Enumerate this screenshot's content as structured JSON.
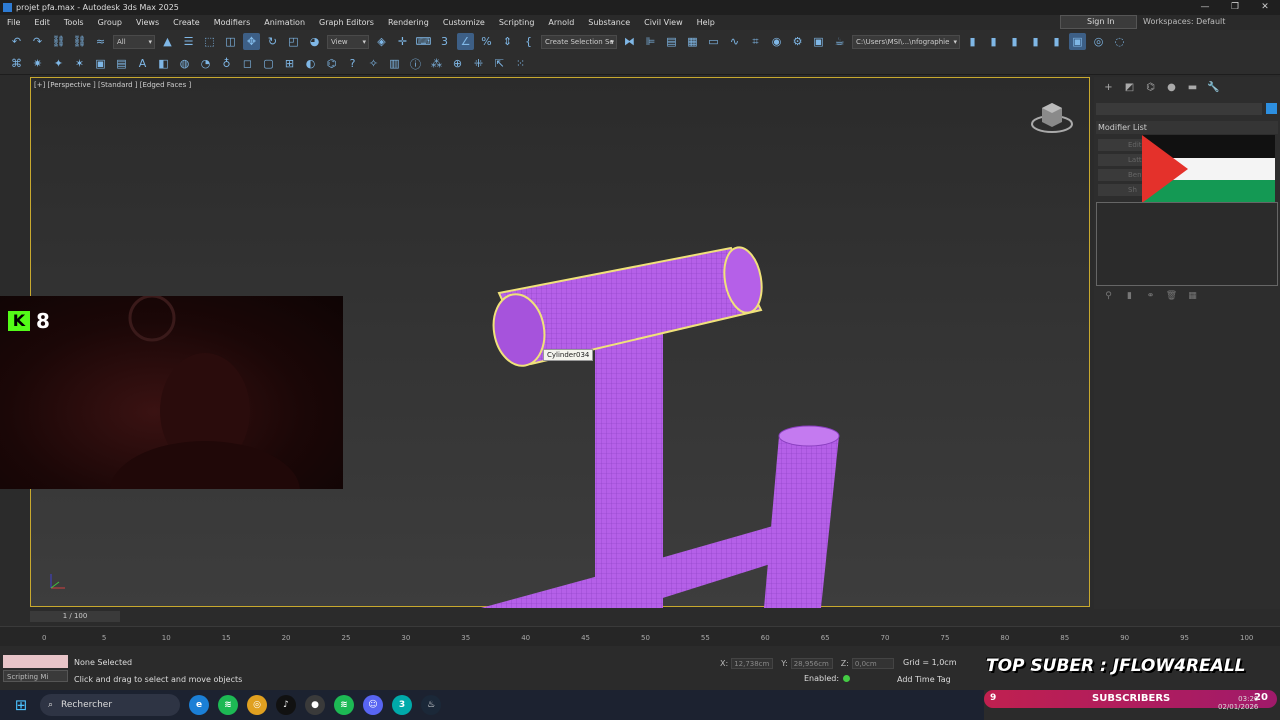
{
  "window": {
    "title": "projet pfa.max - Autodesk 3ds Max 2025",
    "controls": [
      "—",
      "❐",
      "✕"
    ]
  },
  "menu": [
    "File",
    "Edit",
    "Tools",
    "Group",
    "Views",
    "Create",
    "Modifiers",
    "Animation",
    "Graph Editors",
    "Rendering",
    "Customize",
    "Scripting",
    "Arnold",
    "Substance",
    "Civil View",
    "Help"
  ],
  "account": {
    "sign_in": "Sign In",
    "workspaces_label": "Workspaces:",
    "workspace": "Default"
  },
  "toolbar": {
    "filter": "All",
    "ref_coord": "View",
    "selection_set": "Create Selection Se",
    "path": "C:\\Users\\MSI\\...\\nfographie"
  },
  "viewport": {
    "label": "[+] [Perspective ] [Standard ] [Edged Faces ]",
    "tooltip": "Cylinder034",
    "object_color": "#b05fe0",
    "selection_color": "#f0e27a"
  },
  "command_panel": {
    "modifier_list": "Modifier List",
    "modifier_buttons": [
      "Edit",
      "Latt",
      "Ben",
      "Sh"
    ],
    "sel_color": "#2d8fe0"
  },
  "webcam": {
    "kick_logo": "K",
    "viewer_count": "8"
  },
  "timeline": {
    "frame": "1 / 100",
    "ticks": [
      "0",
      "5",
      "10",
      "15",
      "20",
      "25",
      "30",
      "35",
      "40",
      "45",
      "50",
      "55",
      "60",
      "65",
      "70",
      "75",
      "80",
      "85",
      "90",
      "95",
      "100"
    ]
  },
  "status": {
    "maxscript_label": "Scripting Mi",
    "selection": "None Selected",
    "prompt": "Click and drag to select and move objects",
    "x_label": "X:",
    "x_value": "12,738cm",
    "y_label": "Y:",
    "y_value": "28,956cm",
    "z_label": "Z:",
    "z_value": "0,0cm",
    "grid": "Grid = 1,0cm",
    "enabled": "Enabled:",
    "add_time_tag": "Add Time Tag"
  },
  "overlay": {
    "top_suber": "TOP SUBER : JFLOW4REALL",
    "sub_count": "9",
    "subscribers": "SUBSCRIBERS",
    "sub_target": "20"
  },
  "taskbar": {
    "search": "Rechercher",
    "apps": [
      {
        "name": "edge",
        "color": "#1b7fd6",
        "glyph": "e"
      },
      {
        "name": "spotify",
        "color": "#1db954",
        "glyph": "≋"
      },
      {
        "name": "chrome",
        "color": "#e0a020",
        "glyph": "◎"
      },
      {
        "name": "tiktok",
        "color": "#111",
        "glyph": "♪"
      },
      {
        "name": "obs",
        "color": "#3a3a3a",
        "glyph": "●"
      },
      {
        "name": "spotify-2",
        "color": "#1db954",
        "glyph": "≋"
      },
      {
        "name": "discord",
        "color": "#5865f2",
        "glyph": "☺"
      },
      {
        "name": "3dsmax",
        "color": "#0aa",
        "glyph": "3"
      },
      {
        "name": "steam",
        "color": "#1b2838",
        "glyph": "♨"
      }
    ],
    "time": "03:20",
    "date": "02/01/2026"
  }
}
